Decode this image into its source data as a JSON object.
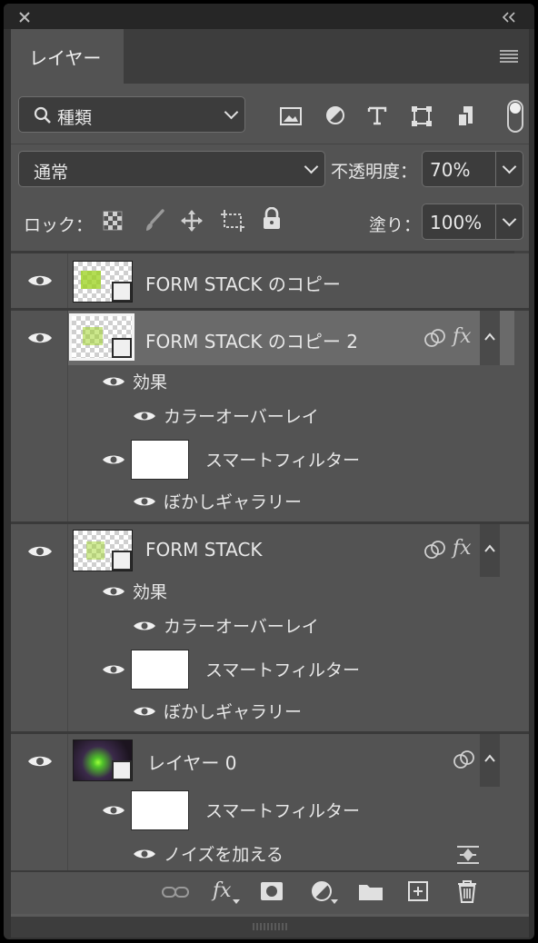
{
  "panel": {
    "title": "レイヤー",
    "filter": {
      "value": "種類"
    },
    "blend_mode": "通常",
    "opacity_label": "不透明度：",
    "opacity_value": "70%",
    "lock_label": "ロック：",
    "fill_label": "塗り：",
    "fill_value": "100%"
  },
  "layers": [
    {
      "name": "FORM STACK のコピー"
    },
    {
      "name": "FORM STACK のコピー 2",
      "effects_label": "効果",
      "effect": "カラーオーバーレイ",
      "smart_filter": "スマートフィルター",
      "filter": "ぼかしギャラリー"
    },
    {
      "name": "FORM STACK",
      "effects_label": "効果",
      "effect": "カラーオーバーレイ",
      "smart_filter": "スマートフィルター",
      "filter": "ぼかしギャラリー"
    },
    {
      "name": "レイヤー 0",
      "smart_filter": "スマートフィルター",
      "filter": "ノイズを加える"
    }
  ],
  "icons": {
    "accent": "#9ad21a",
    "selected_row": "#6a6a6a"
  }
}
